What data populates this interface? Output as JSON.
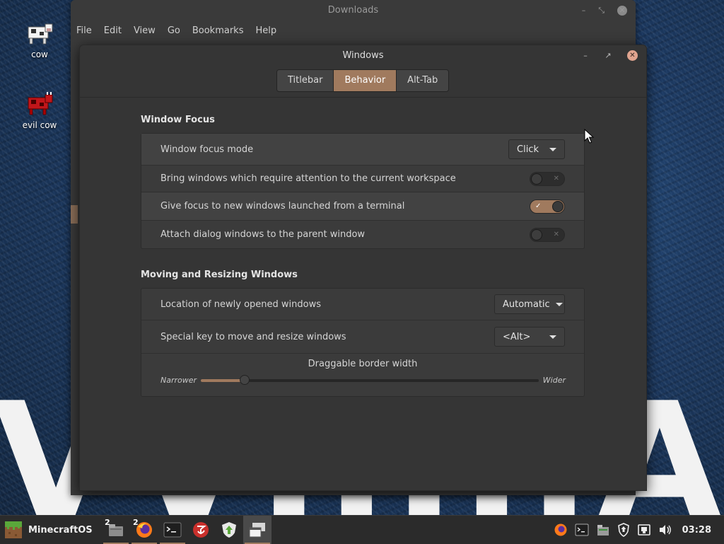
{
  "desktop": {
    "icons": [
      {
        "label": "cow"
      },
      {
        "label": "evil cow"
      }
    ]
  },
  "back_window": {
    "title": "Downloads",
    "menu": [
      "File",
      "Edit",
      "View",
      "Go",
      "Bookmarks",
      "Help"
    ]
  },
  "window": {
    "title": "Windows",
    "tabs": [
      {
        "label": "Titlebar",
        "active": false
      },
      {
        "label": "Behavior",
        "active": true
      },
      {
        "label": "Alt-Tab",
        "active": false
      }
    ],
    "window_focus": {
      "title": "Window Focus",
      "focus_mode_label": "Window focus mode",
      "focus_mode_value": "Click",
      "attention_label": "Bring windows which require attention to the current workspace",
      "attention_on": false,
      "terminal_focus_label": "Give focus to new windows launched from a terminal",
      "terminal_focus_on": true,
      "attach_dialogs_label": "Attach dialog windows to the parent window",
      "attach_dialogs_on": false
    },
    "moving": {
      "title": "Moving and Resizing Windows",
      "location_label": "Location of newly opened windows",
      "location_value": "Automatic",
      "special_key_label": "Special key to move and resize windows",
      "special_key_value": "<Alt>",
      "border_title": "Draggable border width",
      "border_low_label": "Narrower",
      "border_high_label": "Wider",
      "border_fraction": 0.13
    }
  },
  "taskbar": {
    "menu_label": "MinecraftOS",
    "apps": [
      {
        "icon": "file-manager-icon",
        "badge": "2",
        "running": true
      },
      {
        "icon": "firefox-icon",
        "badge": "2",
        "running": true
      },
      {
        "icon": "terminal-icon",
        "badge": "",
        "running": true
      },
      {
        "icon": "app-red-icon",
        "badge": "",
        "running": false
      },
      {
        "icon": "update-manager-icon",
        "badge": "",
        "running": false
      },
      {
        "icon": "window-settings-icon",
        "badge": "",
        "running": true,
        "active": true
      }
    ],
    "clock": "03:28"
  },
  "colors": {
    "accent": "#a07a5e",
    "window_bg": "#353535",
    "card_bg": "#3b3b3b"
  }
}
